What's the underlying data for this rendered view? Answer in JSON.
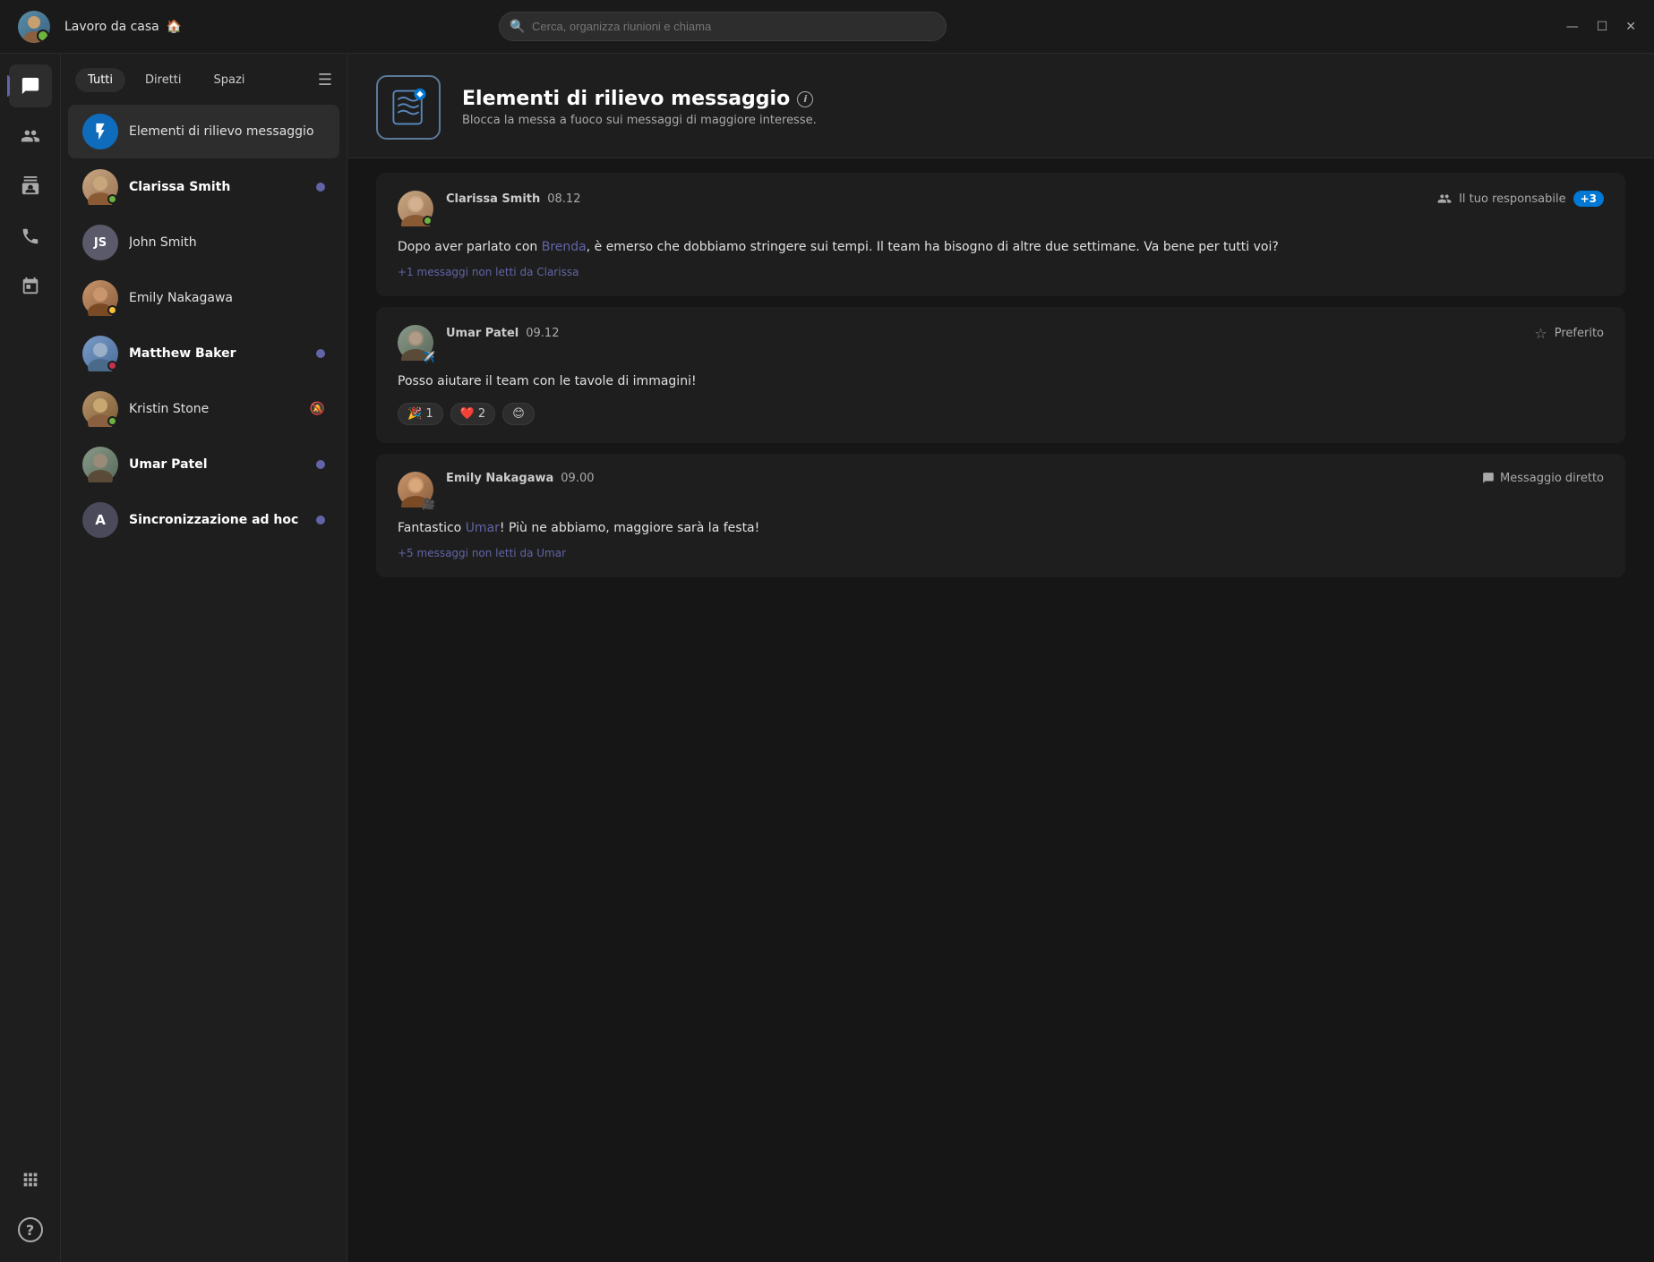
{
  "app": {
    "title": "Lavoro da casa",
    "title_emoji": "🏠",
    "user_status": "online"
  },
  "titlebar": {
    "search_placeholder": "Cerca, organizza riunioni e chiama",
    "controls": [
      "—",
      "☐",
      "✕"
    ]
  },
  "sidebar": {
    "tabs": [
      {
        "id": "tutti",
        "label": "Tutti",
        "active": true
      },
      {
        "id": "diretti",
        "label": "Diretti",
        "active": false
      },
      {
        "id": "spazi",
        "label": "Spazi",
        "active": false
      }
    ],
    "items": [
      {
        "id": "elementi",
        "name": "Elementi di rilievo messaggio",
        "type": "special",
        "active": true,
        "icon": "⚡"
      },
      {
        "id": "clarissa",
        "name": "Clarissa Smith",
        "type": "contact",
        "bold": true,
        "status": "online",
        "unread": true
      },
      {
        "id": "john",
        "name": "John Smith",
        "type": "contact",
        "bold": false,
        "initials": "JS",
        "status": "none",
        "unread": false
      },
      {
        "id": "emily",
        "name": "Emily Nakagawa",
        "type": "contact",
        "bold": false,
        "status": "away",
        "unread": false
      },
      {
        "id": "matthew",
        "name": "Matthew Baker",
        "type": "contact",
        "bold": true,
        "status": "busy",
        "unread": true
      },
      {
        "id": "kristin",
        "name": "Kristin Stone",
        "type": "contact",
        "bold": false,
        "status": "online",
        "unread": false,
        "bell": true
      },
      {
        "id": "umar",
        "name": "Umar Patel",
        "type": "contact",
        "bold": true,
        "status": "none",
        "unread": true
      },
      {
        "id": "sync",
        "name": "Sincronizzazione ad hoc",
        "type": "group",
        "bold": true,
        "unread": true,
        "initials": "A"
      }
    ]
  },
  "main": {
    "header": {
      "title": "Elementi di rilievo messaggio",
      "subtitle": "Blocca la messa a fuoco sui messaggi di maggiore interesse."
    },
    "messages": [
      {
        "id": "msg1",
        "sender": "Clarissa Smith",
        "time": "08.12",
        "tag": "Il tuo responsabile",
        "tag_badge": "+3",
        "tag_icon": "people",
        "body_parts": [
          {
            "type": "text",
            "content": "Dopo aver parlato con "
          },
          {
            "type": "mention",
            "content": "Brenda"
          },
          {
            "type": "text",
            "content": ", è emerso che dobbiamo stringere sui tempi. Il team ha bisogno di altre due settimane. Va bene per tutti voi?"
          }
        ],
        "unread_note": "+1 messaggi non letti da Clarissa",
        "reactions": []
      },
      {
        "id": "msg2",
        "sender": "Umar Patel",
        "time": "09.12",
        "tag": "Preferito",
        "tag_icon": "star",
        "body": "Posso aiutare il team con le tavole di immagini!",
        "unread_note": "",
        "reactions": [
          {
            "emoji": "🎉",
            "count": "1"
          },
          {
            "emoji": "❤️",
            "count": "2"
          },
          {
            "emoji": "😊",
            "count": ""
          }
        ]
      },
      {
        "id": "msg3",
        "sender": "Emily Nakagawa",
        "time": "09.00",
        "tag": "Messaggio diretto",
        "tag_icon": "chat",
        "body_parts": [
          {
            "type": "text",
            "content": "Fantastico "
          },
          {
            "type": "mention",
            "content": "Umar"
          },
          {
            "type": "text",
            "content": "! Più ne abbiamo, maggiore sarà la festa!"
          }
        ],
        "unread_note": "+5 messaggi non letti da Umar"
      }
    ]
  },
  "icons": {
    "chat": "💬",
    "people": "👥",
    "contacts": "👤",
    "calls": "📞",
    "calendar": "📅",
    "add_app": "⊞",
    "help": "?",
    "info": "i",
    "star": "☆",
    "star_filled": "★"
  }
}
